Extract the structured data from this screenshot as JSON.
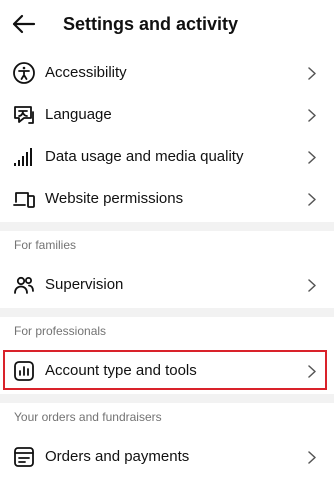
{
  "header": {
    "title": "Settings and activity"
  },
  "items": [
    {
      "label": "Accessibility",
      "icon": "accessibility-icon"
    },
    {
      "label": "Language",
      "icon": "language-icon"
    },
    {
      "label": "Data usage and media quality",
      "icon": "signal-bars-icon"
    },
    {
      "label": "Website permissions",
      "icon": "devices-icon"
    }
  ],
  "families": {
    "header": "For families",
    "items": [
      {
        "label": "Supervision",
        "icon": "people-icon"
      }
    ]
  },
  "professionals": {
    "header": "For professionals",
    "items": [
      {
        "label": "Account type and tools",
        "icon": "chart-icon",
        "highlighted": true
      }
    ]
  },
  "orders": {
    "header": "Your orders and fundraisers",
    "items": [
      {
        "label": "Orders and payments",
        "icon": "receipt-icon"
      }
    ]
  },
  "colors": {
    "highlight": "#d9222a",
    "separator": "#f2f2f2",
    "section_text": "#737373"
  }
}
